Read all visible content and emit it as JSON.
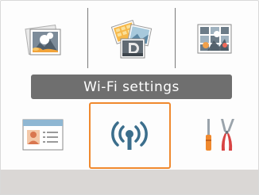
{
  "menu": {
    "title": "Wi-Fi settings",
    "selected_item": "wifi-settings",
    "items": [
      {
        "id": "print-single",
        "icon": "single-photo-icon"
      },
      {
        "id": "print-multiple",
        "icon": "photo-stack-icon"
      },
      {
        "id": "print-index",
        "icon": "photo-grid-icon"
      },
      {
        "id": "id-photo",
        "icon": "id-card-icon"
      },
      {
        "id": "wifi-settings",
        "icon": "wifi-antenna-icon"
      },
      {
        "id": "settings",
        "icon": "tools-icon"
      }
    ]
  },
  "colors": {
    "title_bar": "#6f6f6f",
    "selection_border": "#f0892e",
    "bottom_bar": "#dad7d5",
    "antenna": "#3b6e8c"
  }
}
